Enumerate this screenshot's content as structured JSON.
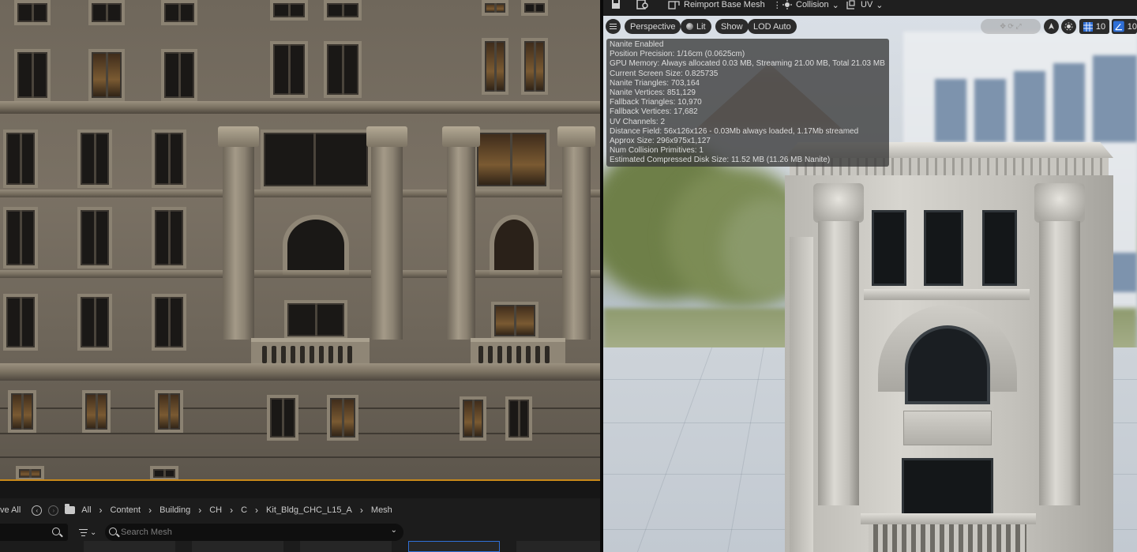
{
  "left_toolbar": {
    "save_all_label": "ve All"
  },
  "breadcrumb": {
    "items": [
      "All",
      "Content",
      "Building",
      "CH",
      "C",
      "Kit_Bldg_CHC_L15_A",
      "Mesh"
    ],
    "separator": "›"
  },
  "content_browser": {
    "search_placeholder": "Search Mesh",
    "left_search_placeholder": ""
  },
  "right_toolbar": {
    "reimport_label": "Reimport Base Mesh",
    "more_label": "⋮",
    "collision_label": "Collision",
    "uv_label": "UV"
  },
  "viewport": {
    "perspective_label": "Perspective",
    "lit_label": "Lit",
    "show_label": "Show",
    "lod_label": "LOD Auto",
    "grid_value": "10",
    "angle_value": "10"
  },
  "stats": [
    "Nanite Enabled",
    "Position Precision: 1/16cm (0.0625cm)",
    "GPU Memory: Always allocated 0.03 MB, Streaming 21.00 MB, Total 21.03 MB",
    "Current Screen Size:  0.825735",
    "Nanite Triangles:  703,164",
    "Nanite Vertices:  851,129",
    "Fallback Triangles:  10,970",
    "Fallback Vertices:  17,682",
    "UV Channels:  2",
    "Distance Field:  56x126x126 - 0.03Mb always loaded, 1.17Mb streamed",
    "Approx Size:  296x975x1,127",
    "Num Collision Primitives:  1",
    "Estimated Compressed Disk Size: 11.52 MB (11.26 MB Nanite)"
  ],
  "colors": {
    "accent_orange": "#c8891a",
    "toolbar_bg": "#1f1f1f",
    "panel_bg": "#1c1c1c",
    "grid_button_active": "#2f6fd6"
  },
  "icons": [
    "save-icon",
    "find-in-browser-icon",
    "reimport-icon",
    "collision-icon",
    "uv-icon",
    "hamburger-icon",
    "lit-sphere-icon",
    "camera-speed-icon",
    "transform-icon",
    "grid-snap-icon",
    "angle-snap-icon",
    "back-icon",
    "forward-icon",
    "folder-icon",
    "search-icon",
    "filter-icon",
    "chevron-down-icon"
  ]
}
